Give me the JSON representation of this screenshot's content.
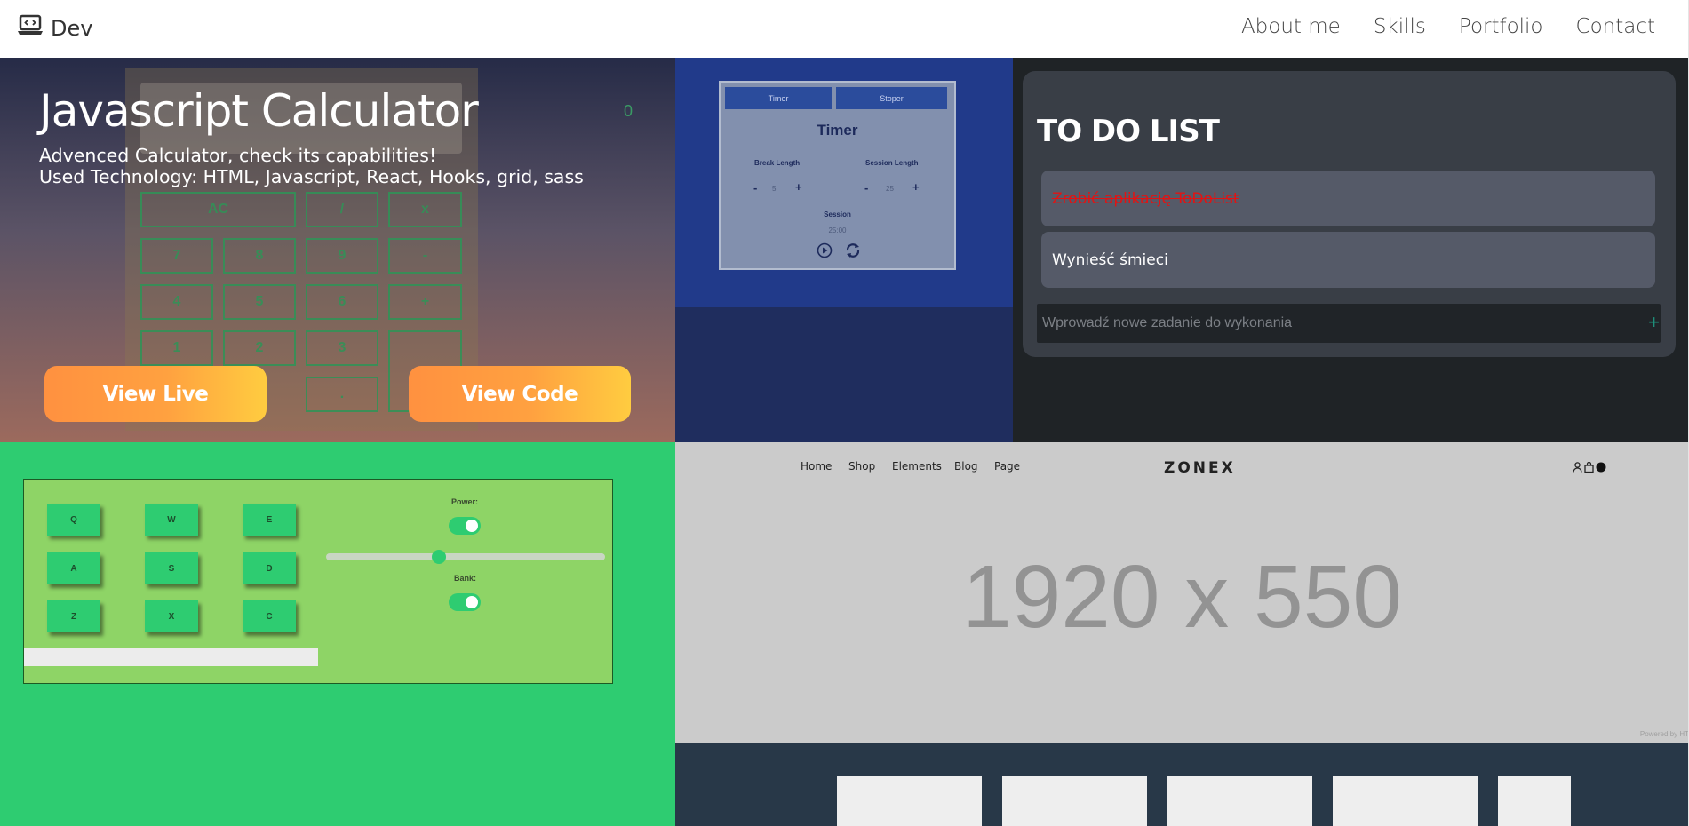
{
  "navbar": {
    "brand": "Dev",
    "brand_icon": "laptop-code-icon",
    "links": [
      "About me",
      "Skills",
      "Portfolio",
      "Contact"
    ]
  },
  "projects": {
    "calculator": {
      "title": "Javascript Calculator",
      "desc_line1": "Advenced Calculator, check its capabilities!",
      "desc_line2": "Used Technology: HTML, Javascript, React, Hooks, grid, sass",
      "view_live": "View Live",
      "view_code": "View Code",
      "display": "0",
      "keys": [
        "AC",
        "/",
        "x",
        "7",
        "8",
        "9",
        "-",
        "4",
        "5",
        "6",
        "+",
        "1",
        "2",
        "3",
        "."
      ]
    },
    "timer": {
      "tab_timer": "Timer",
      "tab_stoper": "Stoper",
      "title": "Timer",
      "break_label": "Break Length",
      "session_label": "Session Length",
      "break_value": "5",
      "session_value": "25",
      "minus": "-",
      "plus": "+",
      "session_title": "Session",
      "time": "25:00",
      "play_icon": "play-circle-icon",
      "reset_icon": "refresh-icon"
    },
    "todo": {
      "title": "TO DO LIST",
      "items": [
        {
          "text": "Zrobić aplikację ToDoList",
          "done": true
        },
        {
          "text": "Wynieść śmieci",
          "done": false
        }
      ],
      "input_placeholder": "Wprowadź nowe zadanie do wykonania",
      "add_icon": "plus-icon"
    },
    "drum": {
      "pads": [
        "Q",
        "W",
        "E",
        "A",
        "S",
        "D",
        "Z",
        "X",
        "C"
      ],
      "power_label": "Power:",
      "bank_label": "Bank:",
      "volume": 0.4
    },
    "zonex": {
      "nav": [
        "Home",
        "Shop",
        "Elements",
        "Blog",
        "Page"
      ],
      "logo": "ZONEX",
      "hero_text": "1920 x 550",
      "powered": "Powered by HT",
      "icons": [
        "user-icon",
        "bag-icon",
        "cart-count-icon"
      ]
    }
  },
  "colors": {
    "accent_orange": "#ff9140",
    "accent_yellow": "#ffcc40",
    "drum_green": "#2ecc71",
    "todo_done_red": "#e01414"
  }
}
